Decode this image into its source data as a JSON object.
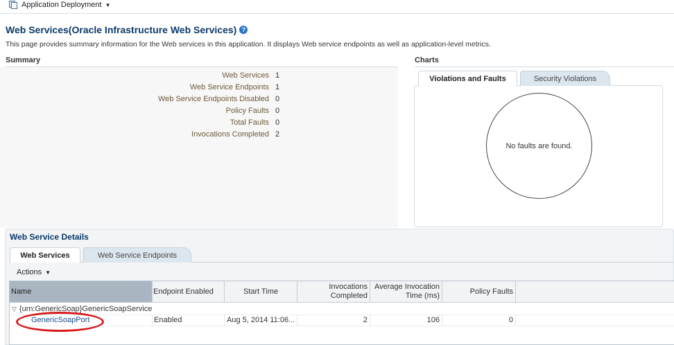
{
  "topbar": {
    "menu_label": "Application Deployment"
  },
  "page": {
    "title": "Web Services(Oracle Infrastructure Web Services)",
    "description": "This page provides summary information for the Web services in this application. It displays Web service endpoints as well as application-level metrics."
  },
  "summary": {
    "heading": "Summary",
    "rows": [
      {
        "label": "Web Services",
        "value": "1"
      },
      {
        "label": "Web Service Endpoints",
        "value": "1"
      },
      {
        "label": "Web Service Endpoints Disabled",
        "value": "0"
      },
      {
        "label": "Policy Faults",
        "value": "0"
      },
      {
        "label": "Total Faults",
        "value": "0"
      },
      {
        "label": "Invocations Completed",
        "value": "2"
      }
    ]
  },
  "charts": {
    "heading": "Charts",
    "tabs": [
      "Violations and Faults",
      "Security Violations"
    ],
    "empty_message": "No faults are found."
  },
  "details": {
    "heading": "Web Service Details",
    "tabs": [
      "Web Services",
      "Web Service Endpoints"
    ],
    "actions_label": "Actions",
    "table": {
      "columns": {
        "name": "Name",
        "endpoint_enabled": "Endpoint Enabled",
        "start_time": "Start Time",
        "invocations_l1": "Invocations",
        "invocations_l2": "Completed",
        "avg_time_l1": "Average Invocation",
        "avg_time_l2": "Time (ms)",
        "policy_faults": "Policy Faults"
      },
      "service_row": {
        "name": "{urn:GenericSoap}GenericSoapService"
      },
      "port_row": {
        "name": "GenericSoapPort",
        "endpoint_enabled": "Enabled",
        "start_time": "Aug 5, 2014 11:06...",
        "invocations": "2",
        "avg_time": "106",
        "policy_faults": "0"
      }
    }
  },
  "colors": {
    "title": "#0b3a6a",
    "highlight_ellipse": "#d81b1b",
    "link": "#1a4b8c"
  }
}
